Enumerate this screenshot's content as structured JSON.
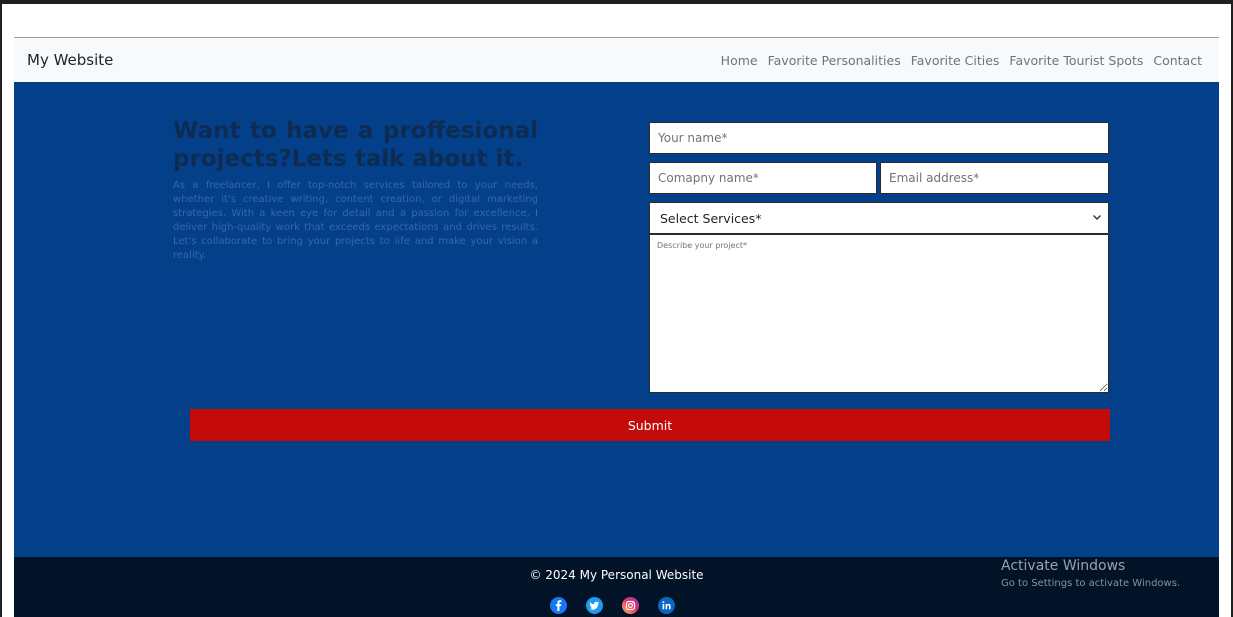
{
  "navbar": {
    "brand": "My Website",
    "links": [
      "Home",
      "Favorite Personalities",
      "Favorite Cities",
      "Favorite Tourist Spots",
      "Contact"
    ]
  },
  "hero": {
    "title": "Want to have a proffesional projects?Lets talk about it.",
    "description": "As a freelancer, I offer top-notch services tailored to your needs, whether it's creative writing, content creation, or digital marketing strategies. With a keen eye for detail and a passion for excellence, I deliver high-quality work that exceeds expectations and drives results. Let's collaborate to bring your projects to life and make your vision a reality."
  },
  "form": {
    "name_placeholder": "Your name*",
    "company_placeholder": "Comapny name*",
    "email_placeholder": "Email address*",
    "services_selected": "Select Services*",
    "description_placeholder": "Describe your project*",
    "submit_label": "Submit"
  },
  "footer": {
    "copyright": "© 2024 My Personal Website",
    "socials": [
      {
        "icon": "facebook-icon",
        "color": "#1877f2"
      },
      {
        "icon": "twitter-icon",
        "color": "#1d9bf0"
      },
      {
        "icon": "instagram-icon",
        "color": "#d6249f"
      },
      {
        "icon": "linkedin-icon",
        "color": "#0a66c2"
      }
    ]
  },
  "watermark": {
    "title": "Activate Windows",
    "subtitle": "Go to Settings to activate Windows."
  },
  "colors": {
    "hero_bg": "#04408a",
    "submit_bg": "#c50a0a",
    "footer_bg": "#021227",
    "navbar_bg": "#f8f9fa"
  }
}
